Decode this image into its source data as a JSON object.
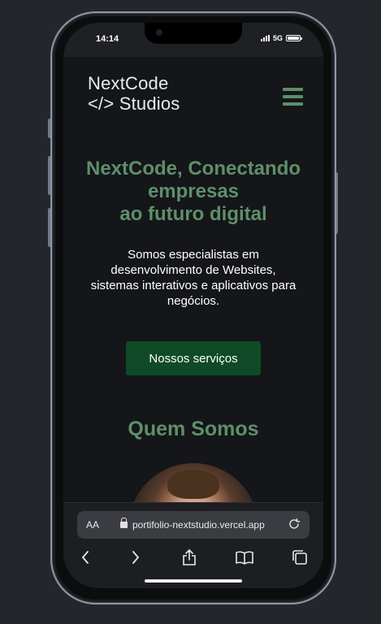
{
  "status": {
    "time": "14:14",
    "network": "5G"
  },
  "header": {
    "logo_line1": "NextCode",
    "logo_line2": "</> Studios"
  },
  "hero": {
    "title_line1": "NextCode, Conectando",
    "title_line2": "empresas",
    "title_line3": "ao futuro digital",
    "description": "Somos especialistas em desenvolvimento de Websites, sistemas interativos e aplicativos para negócios.",
    "cta_label": "Nossos serviços"
  },
  "about": {
    "title": "Quem Somos"
  },
  "browser": {
    "aa_label": "AA",
    "url": "portifolio-nextstudio.vercel.app"
  },
  "icons": {
    "menu": "hamburger-menu-icon",
    "lock": "lock-icon",
    "reload": "reload-icon",
    "back": "chevron-left-icon",
    "forward": "chevron-right-icon",
    "share": "share-icon",
    "bookmarks": "book-icon",
    "tabs": "tabs-icon"
  },
  "colors": {
    "accent_green": "#5e8f6a",
    "button_green": "#0f4a26",
    "background": "#141619"
  }
}
